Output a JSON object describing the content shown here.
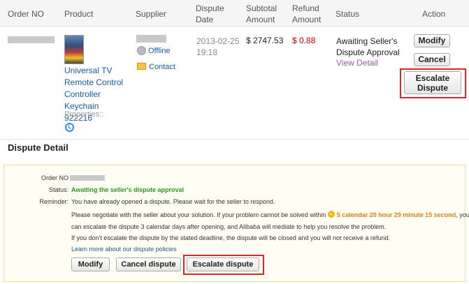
{
  "table": {
    "headers": {
      "order_no": "Order NO",
      "product": "Product",
      "supplier": "Supplier",
      "dispute_date": "Dispute Date",
      "subtotal_amount": "Subtotal Amount",
      "refund_amount": "Refund Amount",
      "status": "Status",
      "action": "Action"
    },
    "row": {
      "product_name": "Universal TV Remote Control Controller Keychain 922216",
      "properties_label": "Properties::",
      "supplier_status": "Offline",
      "contact_label": "Contact",
      "dispute_date": "2013-02-25 19:18",
      "subtotal": "$ 2747.53",
      "refund": "$ 0.88",
      "status_text": "Awaiting Seller's Dispute Approval",
      "view_detail": "View Detail",
      "buttons": {
        "modify": "Modify",
        "cancel": "Cancel",
        "escalate": "Escalate Dispute"
      }
    }
  },
  "detail": {
    "title": "Dispute Detail",
    "order_label": "Order NO",
    "status_label": "Status:",
    "status_value": "Awaiting the seller's dispute approval",
    "reminder_label": "Reminder:",
    "line1": "You have already opened a dispute. Please wait for the seller to respond.",
    "line2_pre": "Please negotiate with the seller about your solution. If your problem cannot be solved within",
    "countdown": "5 calendar 20 hour 29 minute 15 second",
    "line2_post": ", you",
    "line3": "can escalate the dispute 3 calendar days after opening, and Alibaba will mediate to help you resolve the problem.",
    "line4": "If you don't escalate the dispute by the stated deadline, the dispute will be closed and you will not receive a refund.",
    "policy_link": "Learn more about our dispute policies",
    "buttons": {
      "modify": "Modify",
      "cancel": "Cancel dispute",
      "escalate": "Escalate dispute"
    }
  },
  "colors": {
    "status_green": "#2e9a1f",
    "countdown_orange": "#e87e10",
    "refund_red": "#cc0000",
    "link_blue": "#1a5aa6",
    "highlight_red": "#e0252a"
  }
}
